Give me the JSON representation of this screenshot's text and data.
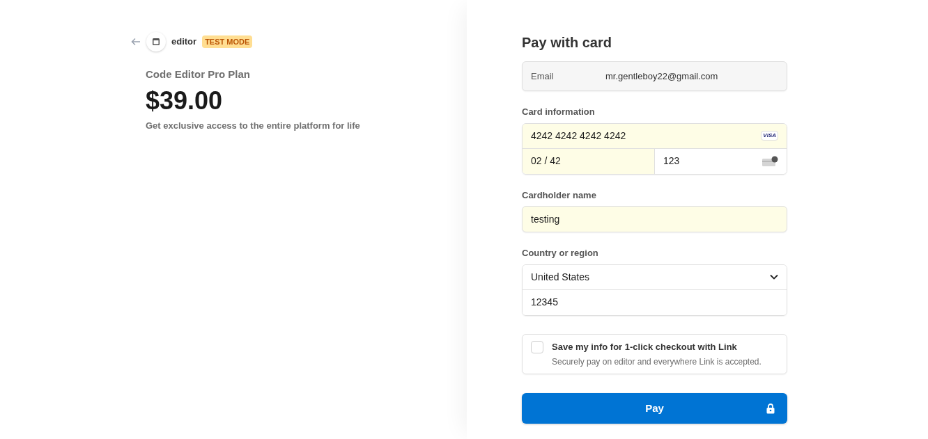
{
  "merchant": {
    "name": "editor",
    "badge": "TEST MODE"
  },
  "product": {
    "name": "Code Editor Pro Plan",
    "price": "$39.00",
    "description": "Get exclusive access to the entire platform for life"
  },
  "form": {
    "title": "Pay with card",
    "email": {
      "label": "Email",
      "value": "mr.gentleboy22@gmail.com"
    },
    "card": {
      "label": "Card information",
      "number": {
        "value": "4242 4242 4242 4242",
        "autofilled": true
      },
      "brand": "VISA",
      "expiry": {
        "value": "02 / 42",
        "autofilled": true
      },
      "cvc": {
        "value": "123",
        "autofilled": false
      }
    },
    "cardholder": {
      "label": "Cardholder name",
      "value": "testing",
      "autofilled": true
    },
    "country": {
      "label": "Country or region",
      "value": "United States",
      "postal": {
        "value": "12345",
        "autofilled": false
      }
    },
    "save": {
      "checked": false,
      "title": "Save my info for 1-click checkout with Link",
      "subtitle": "Securely pay on editor and everywhere Link is accepted."
    },
    "pay_button": "Pay"
  }
}
